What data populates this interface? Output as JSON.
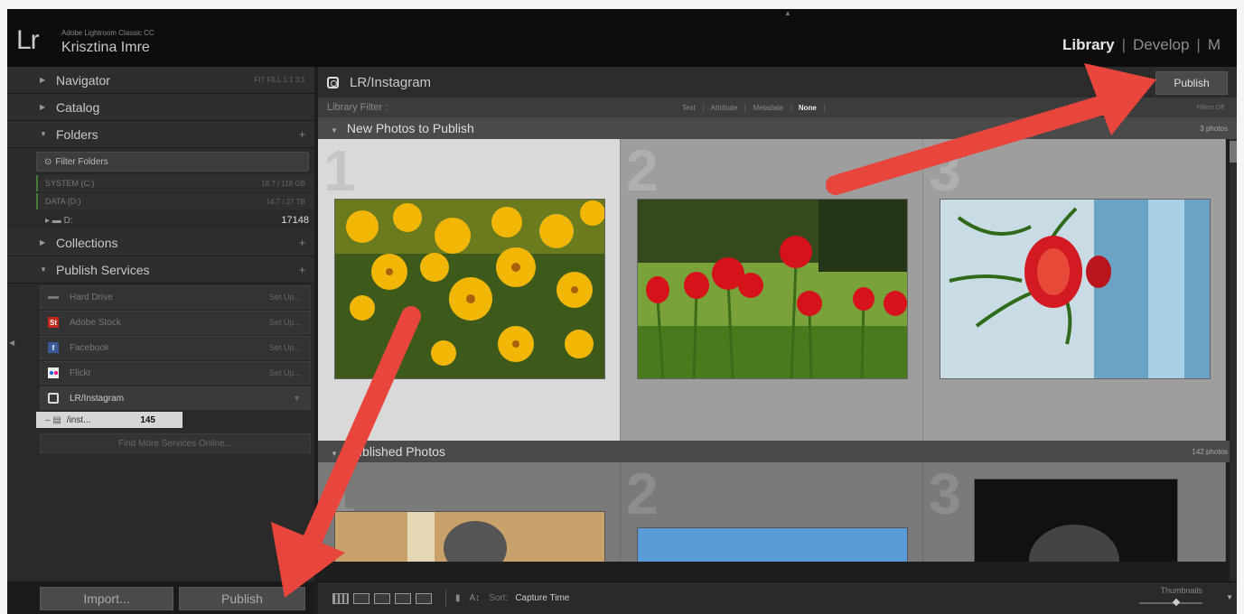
{
  "app": {
    "logo": "Lr",
    "app_name": "Adobe Lightroom Classic CC",
    "user_name": "Krisztina Imre"
  },
  "modules": [
    {
      "label": "Library",
      "active": true
    },
    {
      "label": "Develop",
      "active": false
    },
    {
      "label": "M",
      "active": false
    }
  ],
  "left_panel": {
    "navigator": {
      "label": "Navigator",
      "modes": "FIT  FILL  1:1  3:1"
    },
    "catalog": {
      "label": "Catalog"
    },
    "folders": {
      "label": "Folders",
      "filter_placeholder": "Filter Folders",
      "volumes": [
        {
          "name": "SYSTEM (C:)",
          "size": "18.7 / 118 GB"
        },
        {
          "name": "DATA (D:)",
          "size": "14.7 / 27 TB"
        }
      ],
      "folder": {
        "name": "D:",
        "count": "17148"
      }
    },
    "collections": {
      "label": "Collections"
    },
    "publish_services": {
      "label": "Publish Services",
      "services": [
        {
          "name": "Hard Drive",
          "action": "Set Up...",
          "icon": "hard-drive-icon",
          "color": "#888888"
        },
        {
          "name": "Adobe Stock",
          "action": "Set Up...",
          "icon": "adobe-stock-icon",
          "color": "#c4281b"
        },
        {
          "name": "Facebook",
          "action": "Set Up...",
          "icon": "facebook-icon",
          "color": "#3b5998"
        },
        {
          "name": "Flickr",
          "action": "Set Up...",
          "icon": "flickr-icon",
          "color": "#ff0084"
        },
        {
          "name": "LR/Instagram",
          "action": "",
          "icon": "instagram-icon",
          "color": "#dddddd"
        }
      ],
      "collection": {
        "name": "/inst...",
        "count": "145"
      },
      "find_more": "Find More Services Online..."
    },
    "import_button": "Import...",
    "publish_button": "Publish"
  },
  "main": {
    "title": "LR/Instagram",
    "publish_button": "Publish",
    "filter": {
      "label": "Library Filter :",
      "tabs": [
        "Text",
        "Attribute",
        "Metadata",
        "None"
      ],
      "selected": "None",
      "filters_off": "Filters Off"
    },
    "new_section": {
      "label": "New Photos to Publish",
      "count": "3 photos"
    },
    "published_section": {
      "label": "Published Photos",
      "count": "142 photos"
    },
    "grid_numbers": [
      "1",
      "2",
      "3"
    ],
    "toolbar": {
      "sort_label": "Sort:",
      "sort_value": "Capture Time",
      "thumbnails_label": "Thumbnails"
    }
  },
  "colors": {
    "arrow": "#e8453c",
    "accent_green": "#4a7a3a"
  }
}
